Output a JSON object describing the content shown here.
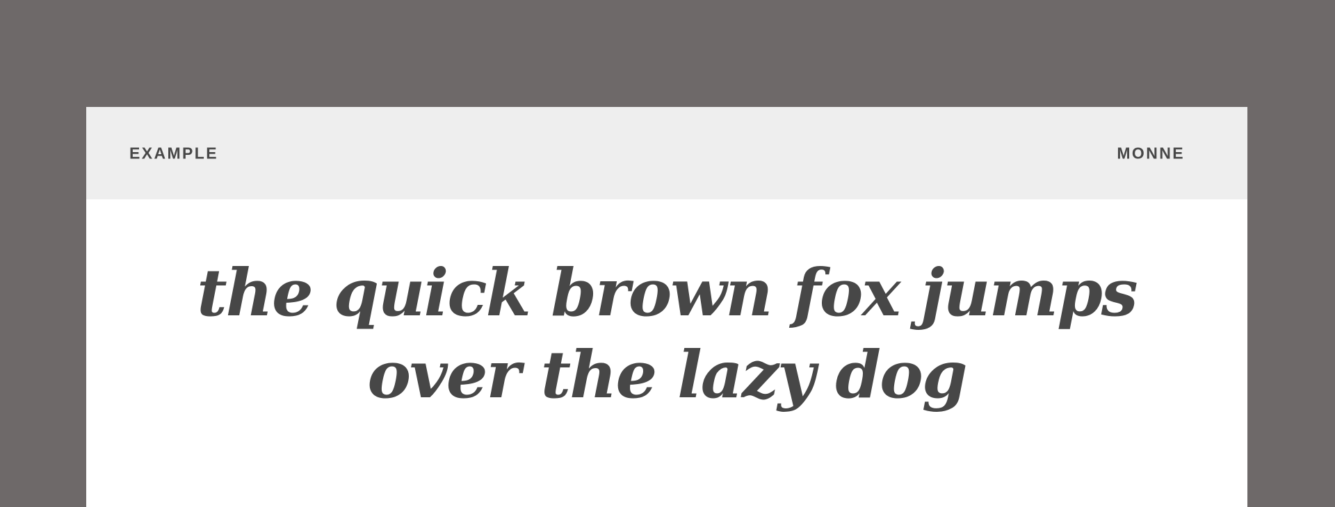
{
  "header": {
    "left_label": "EXAMPLE",
    "right_label": "MONNE"
  },
  "specimen": {
    "lines": [
      "the quick brown fox jumps",
      "over the lazy dog"
    ]
  },
  "colors": {
    "page_background": "#6e6969",
    "header_background": "#eeeeee",
    "card_background": "#ffffff",
    "text": "#474747"
  }
}
